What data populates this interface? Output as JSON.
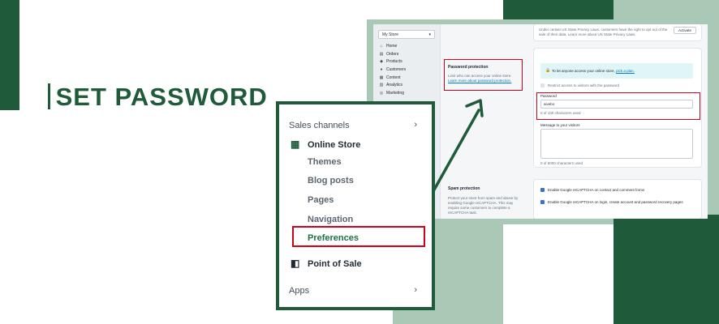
{
  "heading": "SET PASSWORD",
  "colors": {
    "brand": "#1f5b3a",
    "light": "#a9c8b5",
    "highlight": "#d0021b",
    "link": "#007ace"
  },
  "admin": {
    "store_selector": "My Store",
    "nav": [
      {
        "icon": "home-icon",
        "glyph": "⌂",
        "label": "Home"
      },
      {
        "icon": "orders-icon",
        "glyph": "▤",
        "label": "Orders"
      },
      {
        "icon": "tag-icon",
        "glyph": "◆",
        "label": "Products"
      },
      {
        "icon": "person-icon",
        "glyph": "●",
        "label": "Customers"
      },
      {
        "icon": "content-icon",
        "glyph": "▦",
        "label": "Content"
      },
      {
        "icon": "analytics-icon",
        "glyph": "▥",
        "label": "Analytics"
      },
      {
        "icon": "target-icon",
        "glyph": "◎",
        "label": "Marketing"
      }
    ],
    "privacy_notice": "Under certain US State Privacy Laws, customers have the right to opt out of the sale of their data. Learn more about US State Privacy Laws.",
    "activate_label": "Activate",
    "password_section": {
      "title": "Password protection",
      "description": "Limit who can access your online store.",
      "learn_more": "Learn more about password protection.",
      "info_text": "To let anyone access your online store,",
      "info_link": "pick a plan.",
      "restrict_label": "Restrict access to visitors with the password",
      "password_label": "Password",
      "password_value": "aivebo",
      "password_help": "0 of 100 characters used",
      "message_label": "Message to your visitors",
      "message_help": "0 of 5000 characters used"
    },
    "spam_section": {
      "title": "Spam protection",
      "description": "Protect your store from spam and abuse by enabling Google reCAPTCHA. This may require some customers to complete a reCAPTCHA task.",
      "option_1": "Enable Google reCAPTCHA on contact and comment forms",
      "option_2": "Enable Google reCAPTCHA on login, create account and password recovery pages"
    }
  },
  "zoom_sidebar": {
    "sales_channels": "Sales channels",
    "online_store": "Online Store",
    "sub_items": [
      "Themes",
      "Blog posts",
      "Pages",
      "Navigation",
      "Preferences"
    ],
    "active_item": "Preferences",
    "point_of_sale": "Point of Sale",
    "apps": "Apps"
  }
}
